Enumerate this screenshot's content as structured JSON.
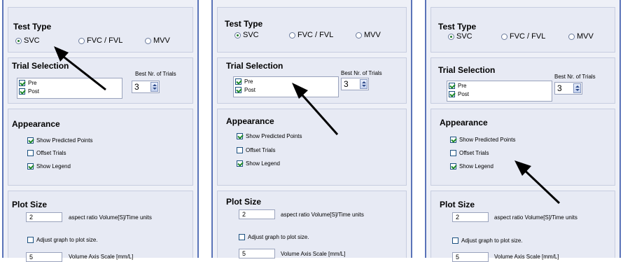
{
  "panels": [
    {
      "test_type": {
        "title": "Test Type",
        "options": [
          "SVC",
          "FVC / FVL",
          "MVV"
        ],
        "selected": "SVC"
      },
      "trial_selection": {
        "title": "Trial Selection",
        "trials": [
          {
            "label": "Pre",
            "checked": true
          },
          {
            "label": "Post",
            "checked": true
          }
        ],
        "best_label": "Best Nr. of Trials",
        "best_value": "3"
      },
      "appearance": {
        "title": "Appearance",
        "items": [
          {
            "label": "Show Predicted Points",
            "checked": true
          },
          {
            "label": "Offset Trials",
            "checked": false
          },
          {
            "label": "Show Legend",
            "checked": true
          }
        ]
      },
      "plot_size": {
        "title": "Plot Size",
        "aspect_value": "2",
        "aspect_label": "aspect ratio Volume[S]/Time units",
        "adjust_label": "Adjust graph to plot size.",
        "adjust_checked": false,
        "scale_value": "5",
        "scale_label": "Volume Axis Scale [mm/L]"
      }
    },
    {
      "test_type": {
        "title": "Test Type",
        "options": [
          "SVC",
          "FVC / FVL",
          "MVV"
        ],
        "selected": "SVC"
      },
      "trial_selection": {
        "title": "Trial Selection",
        "trials": [
          {
            "label": "Pre",
            "checked": true
          },
          {
            "label": "Post",
            "checked": true
          }
        ],
        "best_label": "Best Nr. of Trials",
        "best_value": "3"
      },
      "appearance": {
        "title": "Appearance",
        "items": [
          {
            "label": "Show Predicted Points",
            "checked": true
          },
          {
            "label": "Offset Trials",
            "checked": false
          },
          {
            "label": "Show Legend",
            "checked": true
          }
        ]
      },
      "plot_size": {
        "title": "Plot Size",
        "aspect_value": "2",
        "aspect_label": "aspect ratio Volume[S]/Time units",
        "adjust_label": "Adjust graph to plot size.",
        "adjust_checked": false,
        "scale_value": "5",
        "scale_label": "Volume Axis Scale [mm/L]"
      }
    },
    {
      "test_type": {
        "title": "Test Type",
        "options": [
          "SVC",
          "FVC / FVL",
          "MVV"
        ],
        "selected": "SVC"
      },
      "trial_selection": {
        "title": "Trial Selection",
        "trials": [
          {
            "label": "Pre",
            "checked": true
          },
          {
            "label": "Post",
            "checked": true
          }
        ],
        "best_label": "Best Nr. of Trials",
        "best_value": "3"
      },
      "appearance": {
        "title": "Appearance",
        "items": [
          {
            "label": "Show Predicted Points",
            "checked": true
          },
          {
            "label": "Offset Trials",
            "checked": false
          },
          {
            "label": "Show Legend",
            "checked": true
          }
        ]
      },
      "plot_size": {
        "title": "Plot Size",
        "aspect_value": "2",
        "aspect_label": "aspect ratio Volume[S]/Time units",
        "adjust_label": "Adjust graph to plot size.",
        "adjust_checked": false,
        "scale_value": "5",
        "scale_label": "Volume Axis Scale [mm/L]"
      }
    }
  ],
  "colors": {
    "panel_border": "#5a73b8",
    "section_bg": "#e7eaf4",
    "check_green": "#1f8a2a",
    "arrow": "#000000"
  }
}
